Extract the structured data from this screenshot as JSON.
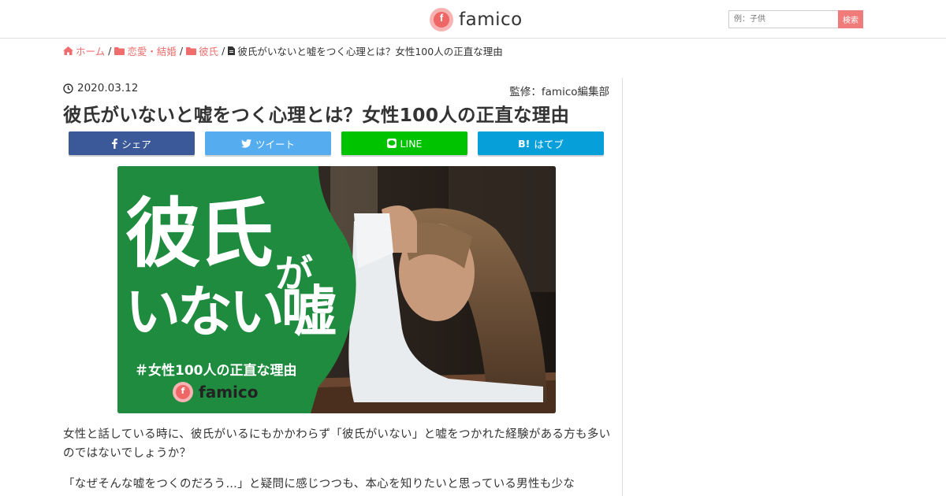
{
  "header": {
    "logo_text": "famico",
    "logo_mark": "f",
    "search_placeholder": "例：子供",
    "search_button": "検索"
  },
  "breadcrumb": {
    "home": "ホーム",
    "cat1": "恋愛・結婚",
    "cat2": "彼氏",
    "current": "彼氏がいないと嘘をつく心理とは？女性100人の正直な理由",
    "sep": "/"
  },
  "article": {
    "date": "2020.03.12",
    "supervisor": "監修：famico編集部",
    "title": "彼氏がいないと嘘をつく心理とは？女性100人の正直な理由",
    "share": {
      "facebook": "シェア",
      "twitter": "ツイート",
      "line": "LINE",
      "hatena_mark": "B!",
      "hatena": "はてブ"
    },
    "hero": {
      "line1": "彼氏",
      "ga": "が",
      "line2": "いない嘘",
      "sub": "＃女性100人の正直な理由",
      "logo": "famico",
      "logo_mark": "f"
    },
    "paragraph1": "女性と話している時に、彼氏がいるにもかかわらず「彼氏がいない」と嘘をつかれた経験がある方も多いのではないでしょうか？",
    "paragraph2": "「なぜそんな嘘をつくのだろう…」と疑問に感じつつも、本心を知りたいと思っている男性も少な"
  },
  "colors": {
    "accent": "#ef6d6d",
    "facebook": "#3b5998",
    "twitter": "#55acee",
    "line": "#00c300",
    "hatena": "#079fd9",
    "hero_green": "#1f8b3f"
  }
}
